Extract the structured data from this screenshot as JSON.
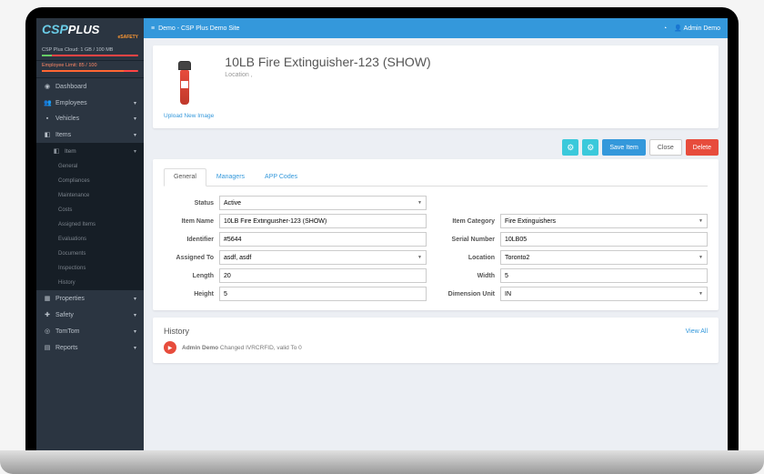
{
  "brand": {
    "csp": "CSP",
    "plus": "PLUS",
    "sub": "eSAFETY"
  },
  "cloud": {
    "label": "CSP Plus Cloud: 1 GB / 100 MB"
  },
  "employees": {
    "label": "Employee Limit: 85 / 100"
  },
  "nav": {
    "dashboard": "Dashboard",
    "employees": "Employees",
    "vehicles": "Vehicles",
    "items": "Items",
    "item": "Item",
    "general": "General",
    "compliances": "Compliances",
    "maintenance": "Maintenance",
    "costs": "Costs",
    "assigned": "Assigned Items",
    "evaluations": "Evaluations",
    "documents": "Documents",
    "inspections": "Inspections",
    "history": "History",
    "properties": "Properties",
    "safety": "Safety",
    "tomtom": "TomTom",
    "reports": "Reports"
  },
  "topbar": {
    "breadcrumb": "Demo - CSP Plus Demo Site",
    "user": "Admin Demo"
  },
  "header": {
    "title": "10LB Fire Extinguisher-123 (SHOW)",
    "location": "Location ,",
    "upload": "Upload New Image"
  },
  "actions": {
    "save": "Save Item",
    "close": "Close",
    "delete": "Delete"
  },
  "tabs": {
    "general": "General",
    "managers": "Managers",
    "appcodes": "APP Codes"
  },
  "form": {
    "status_label": "Status",
    "status": "Active",
    "name_label": "Item Name",
    "name": "10LB Fire Extinguisher-123 (SHOW)",
    "category_label": "Item Category",
    "category": "Fire Extinguishers",
    "identifier_label": "Identifier",
    "identifier": "#5644",
    "serial_label": "Serial Number",
    "serial": "10LB05",
    "assigned_label": "Assigned To",
    "assigned": "asdf, asdf",
    "location_label": "Location",
    "location": "Toronto2",
    "length_label": "Length",
    "length": "20",
    "width_label": "Width",
    "width": "5",
    "height_label": "Height",
    "height": "5",
    "unit_label": "Dimension Unit",
    "unit": "IN"
  },
  "history": {
    "title": "History",
    "viewall": "View All",
    "entry_user": "Admin Demo",
    "entry_text": "Changed IVRCRFID, valid To 0"
  }
}
